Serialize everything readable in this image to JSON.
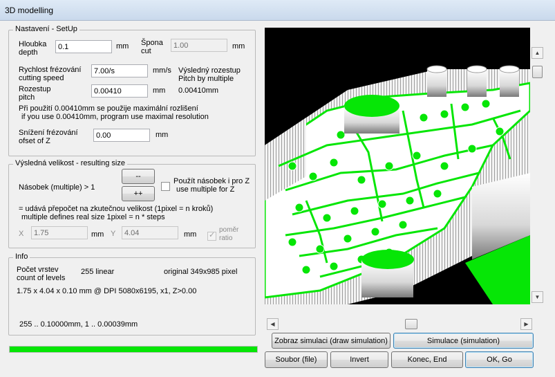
{
  "window": {
    "title": "3D modelling"
  },
  "setup": {
    "title": "Nastavení - SetUp",
    "depth": {
      "label1": "Hloubka",
      "label2": "depth",
      "value": "0.1",
      "unit": "mm"
    },
    "cut": {
      "label1": "Špona",
      "label2": "cut",
      "value": "1.00",
      "unit": "mm"
    },
    "speed": {
      "label1": "Rychlost frézování",
      "label2": "cutting speed",
      "value": "7.00/s",
      "unit": "mm/s"
    },
    "result_pitch": {
      "label1": "Výsledný rozestup",
      "label2": "Pitch by multiple",
      "value": "0.00410mm"
    },
    "pitch": {
      "label1": "Rozestup",
      "label2": "pitch",
      "value": "0.00410",
      "unit": "mm"
    },
    "note1": "Při použití 0.00410mm se použije maximální rozlišení",
    "note2": "if you use 0.00410mm, program use maximal resolution",
    "offset": {
      "label1": "Snížení frézování",
      "label2": "ofset of Z",
      "value": "0.00",
      "unit": "mm"
    }
  },
  "size": {
    "title": "Výsledná velikost - resulting size",
    "multiple_label": "Násobek (multiple) > 1",
    "minus_label": "--",
    "plus_label": "++",
    "use_z_label1": "Použít násobek i pro Z",
    "use_z_label2": "use multiple for Z",
    "explain1": "= udává přepočet na zkutečnou velikost (1pixel = n kroků)",
    "explain2": "multiple defines real size 1pixel = n * steps",
    "x_label": "X",
    "x_value": "1.75",
    "x_unit": "mm",
    "y_label": "Y",
    "y_value": "4.04",
    "y_unit": "mm",
    "ratio_label1": "poměr",
    "ratio_label2": "ratio"
  },
  "info": {
    "title": "Info",
    "levels_label1": "Počet vrstev",
    "levels_label2": "count of levels",
    "levels_value": "255 linear",
    "original": "original 349x985 pixel",
    "dims": "1.75 x 4.04 x 0.10 mm @ DPI 5080x6195, x1, Z>0.00",
    "range": "255 .. 0.10000mm, 1 .. 0.00039mm"
  },
  "progress_value": 1.0,
  "buttons": {
    "draw_sim": "Zobraz simulaci (draw simulation)",
    "simulation": "Simulace (simulation)",
    "file": "Soubor (file)",
    "invert": "Invert",
    "end": "Konec, End",
    "ok": "OK, Go"
  },
  "colors": {
    "accent_green": "#06e606",
    "view_bg": "#000000"
  },
  "scroll": {
    "vertical_position": 0.03,
    "horizontal_position": 0.55
  }
}
